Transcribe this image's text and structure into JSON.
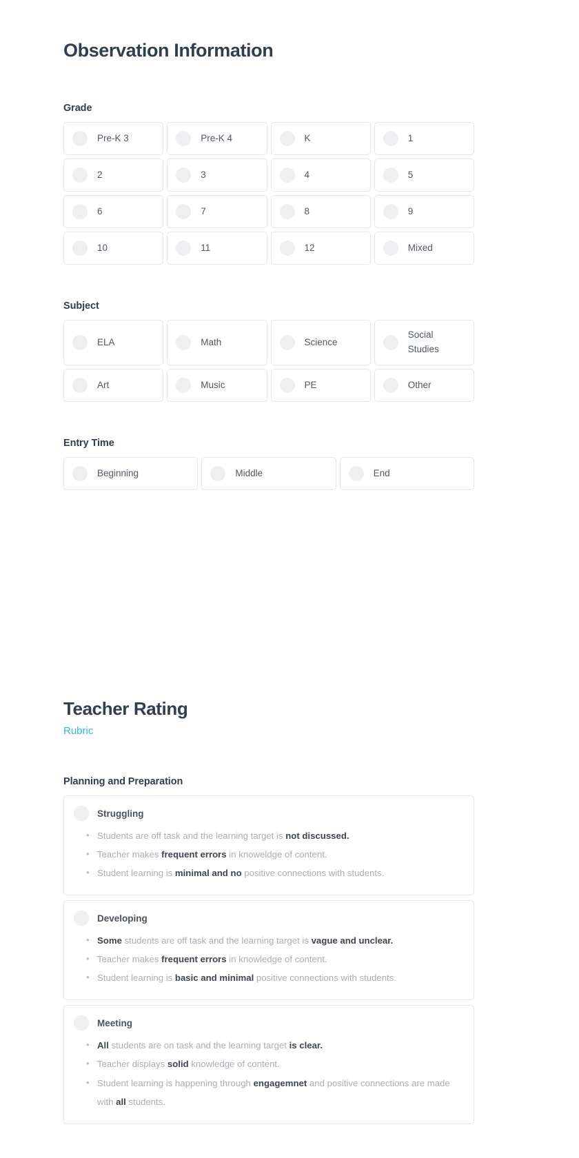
{
  "observation": {
    "title": "Observation Information",
    "grade": {
      "label": "Grade",
      "options": [
        "Pre-K 3",
        "Pre-K 4",
        "K",
        "1",
        "2",
        "3",
        "4",
        "5",
        "6",
        "7",
        "8",
        "9",
        "10",
        "11",
        "12",
        "Mixed"
      ]
    },
    "subject": {
      "label": "Subject",
      "options": [
        "ELA",
        "Math",
        "Science",
        "Social Studies",
        "Art",
        "Music",
        "PE",
        "Other"
      ]
    },
    "entry_time": {
      "label": "Entry Time",
      "options": [
        "Beginning",
        "Middle",
        "End"
      ]
    }
  },
  "teacher_rating": {
    "title": "Teacher Rating",
    "rubric_link": "Rubric",
    "domain_label": "Planning and Preparation",
    "levels": [
      {
        "name": "Struggling",
        "bullets": [
          [
            {
              "t": "Students are off task and the learning target is ",
              "b": false
            },
            {
              "t": "not discussed.",
              "b": true
            }
          ],
          [
            {
              "t": "Teacher makes ",
              "b": false
            },
            {
              "t": "frequent errors",
              "b": true
            },
            {
              "t": " in knoweldge of content.",
              "b": false
            }
          ],
          [
            {
              "t": "Student learning is ",
              "b": false
            },
            {
              "t": "minimal and no",
              "b": true
            },
            {
              "t": " positive connections with students.",
              "b": false
            }
          ]
        ]
      },
      {
        "name": "Developing",
        "bullets": [
          [
            {
              "t": "Some",
              "b": true
            },
            {
              "t": " students are off task and the learning target is ",
              "b": false
            },
            {
              "t": "vague and unclear.",
              "b": true
            }
          ],
          [
            {
              "t": "Teacher makes ",
              "b": false
            },
            {
              "t": "frequent errors",
              "b": true
            },
            {
              "t": " in knowledge of content.",
              "b": false
            }
          ],
          [
            {
              "t": "Student learning is ",
              "b": false
            },
            {
              "t": "basic and minimal",
              "b": true
            },
            {
              "t": " positive connections with students.",
              "b": false
            }
          ]
        ]
      },
      {
        "name": "Meeting",
        "bullets": [
          [
            {
              "t": "All",
              "b": true
            },
            {
              "t": " students are on task and the learning target ",
              "b": false
            },
            {
              "t": "is clear.",
              "b": true
            }
          ],
          [
            {
              "t": "Teacher displays ",
              "b": false
            },
            {
              "t": "solid",
              "b": true
            },
            {
              "t": " knowledge of content.",
              "b": false
            }
          ],
          [
            {
              "t": "Student learning is happening through ",
              "b": false
            },
            {
              "t": "engagemnet",
              "b": true
            },
            {
              "t": " and positive connections are made with ",
              "b": false
            },
            {
              "t": "all",
              "b": true
            },
            {
              "t": " students.",
              "b": false
            }
          ]
        ]
      }
    ]
  }
}
